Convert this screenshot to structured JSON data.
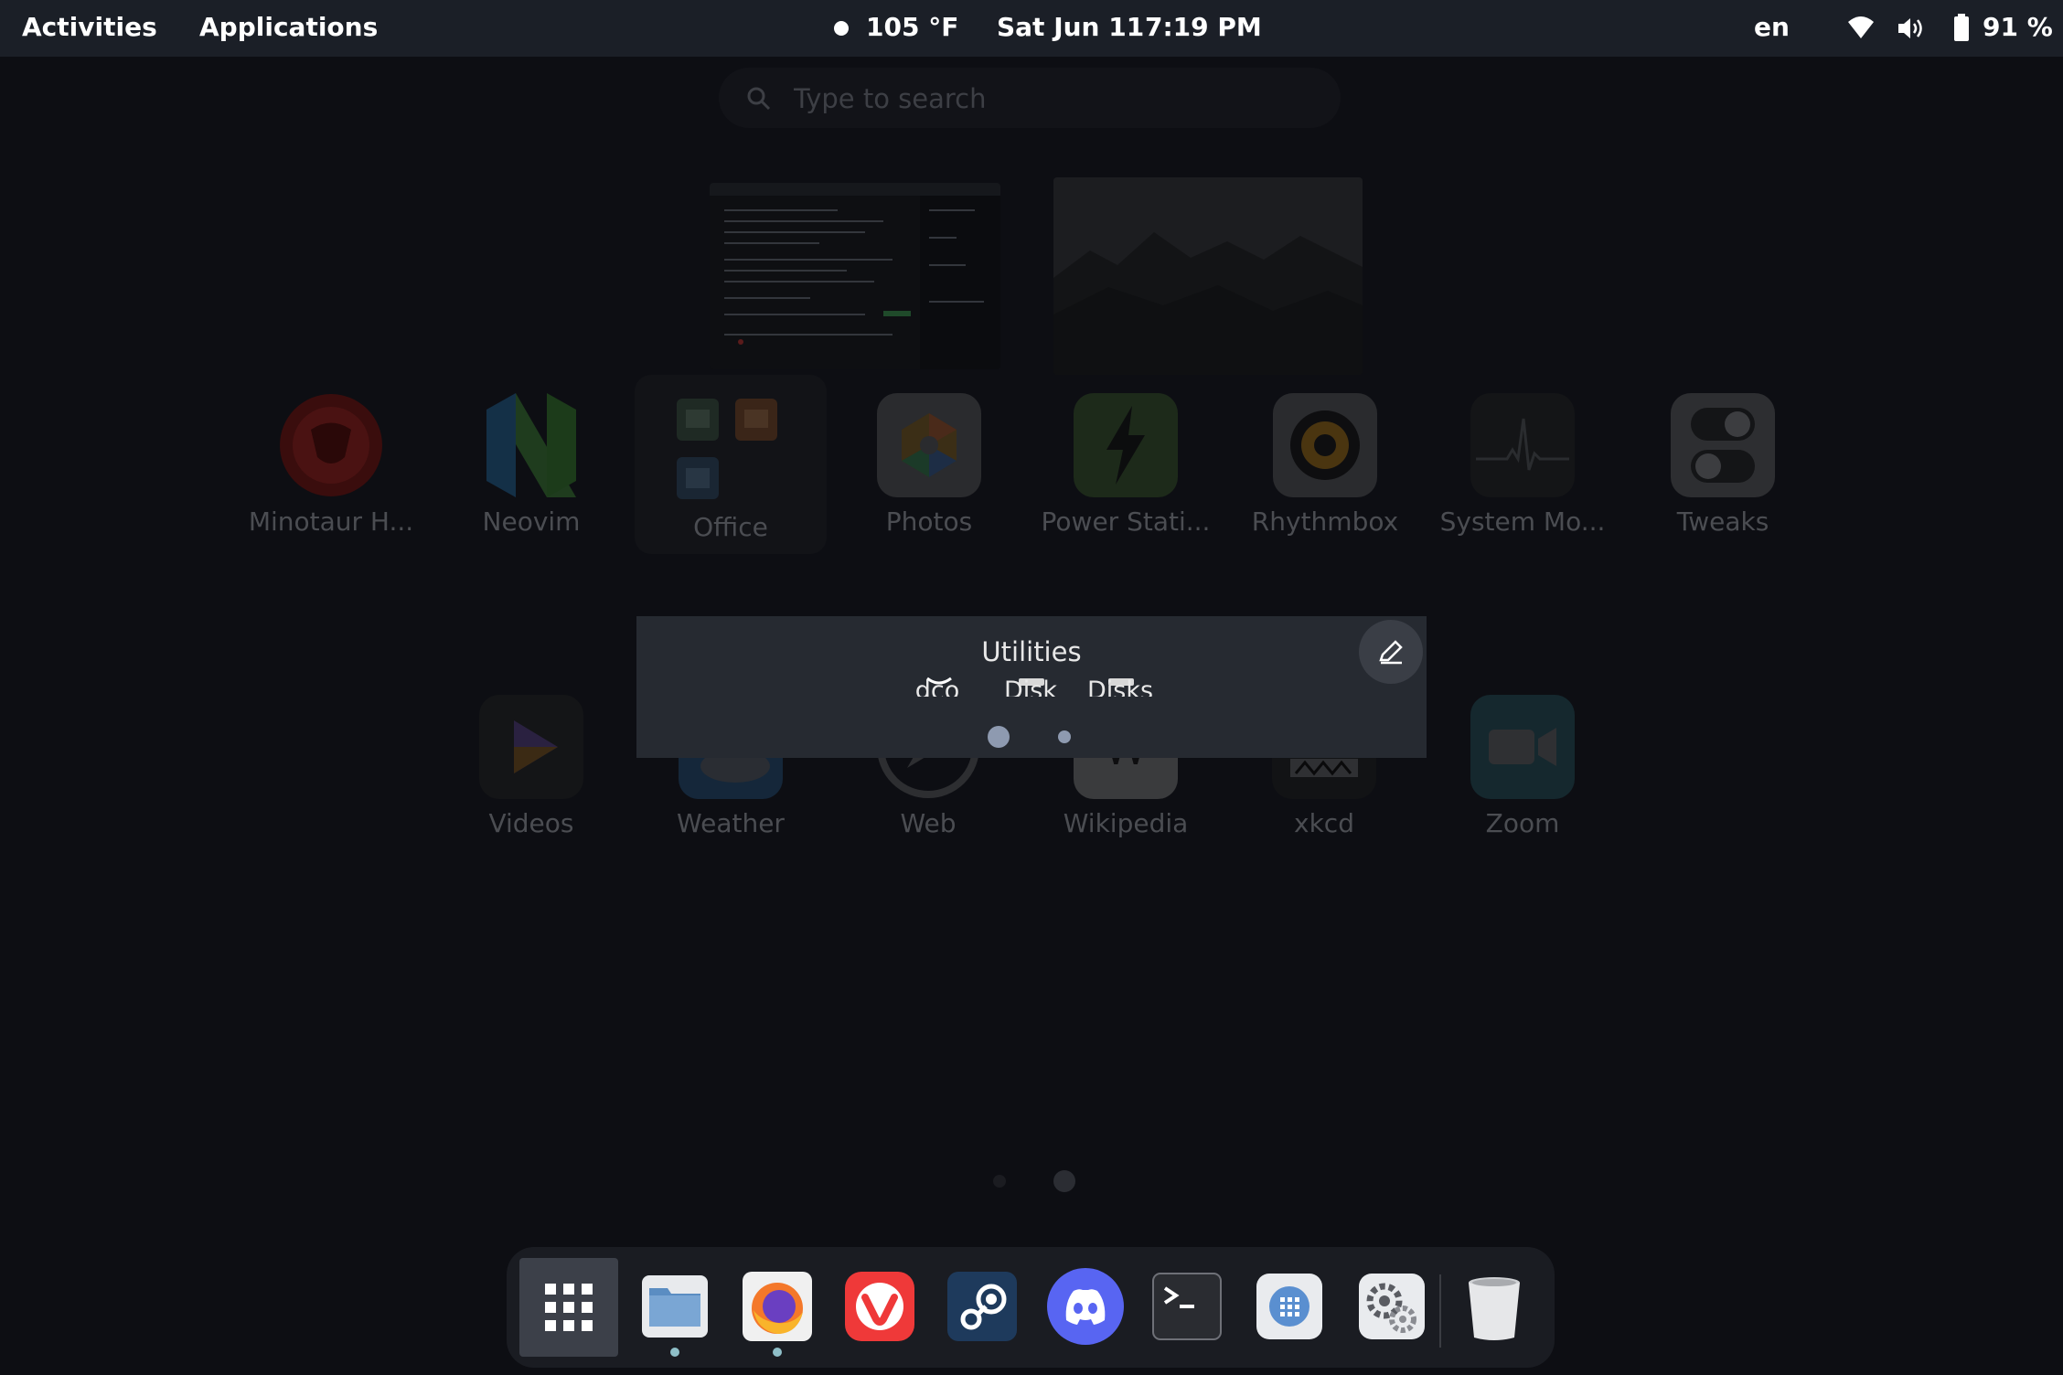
{
  "topbar": {
    "activities": "Activities",
    "applications": "Applications",
    "weather_temp": "105 °F",
    "date": "Sat Jun 11",
    "time": "7:19 PM",
    "keyboard_layout": "en",
    "battery_percent": "91 %"
  },
  "search": {
    "placeholder": "Type to search"
  },
  "apps_row1": [
    {
      "label": "Minotaur H..."
    },
    {
      "label": "Neovim"
    },
    {
      "label": "Office"
    },
    {
      "label": "Photos"
    },
    {
      "label": "Power Stati..."
    },
    {
      "label": "Rhythmbox"
    },
    {
      "label": "System Mo..."
    },
    {
      "label": "Tweaks"
    }
  ],
  "apps_row2": [
    {
      "label": "Videos"
    },
    {
      "label": "Weather"
    },
    {
      "label": "Web"
    },
    {
      "label": "Wikipedia"
    },
    {
      "label": "xkcd"
    },
    {
      "label": "Zoom"
    }
  ],
  "folder": {
    "title": "Utilities",
    "items": [
      {
        "label": "dco"
      },
      {
        "label": "Disk"
      },
      {
        "label": "Disks"
      }
    ]
  },
  "dock": {
    "items": [
      {
        "icon": "app-grid-icon",
        "running": false
      },
      {
        "icon": "files-icon",
        "running": true
      },
      {
        "icon": "firefox-icon",
        "running": true
      },
      {
        "icon": "vivaldi-icon",
        "running": false
      },
      {
        "icon": "steam-icon",
        "running": false
      },
      {
        "icon": "discord-icon",
        "running": false
      },
      {
        "icon": "terminal-icon",
        "running": false
      },
      {
        "icon": "software-icon",
        "running": false
      },
      {
        "icon": "settings-icon",
        "running": false
      },
      {
        "icon": "trash-icon",
        "running": false
      }
    ]
  },
  "colors": {
    "topbar_bg": "#1b1f27",
    "overview_bg": "#0d0e13",
    "folder_bg": "#262a31",
    "discord_blurple": "#5865f2",
    "vivaldi_red": "#ef3939",
    "running_indicator": "#8fbfc8"
  }
}
